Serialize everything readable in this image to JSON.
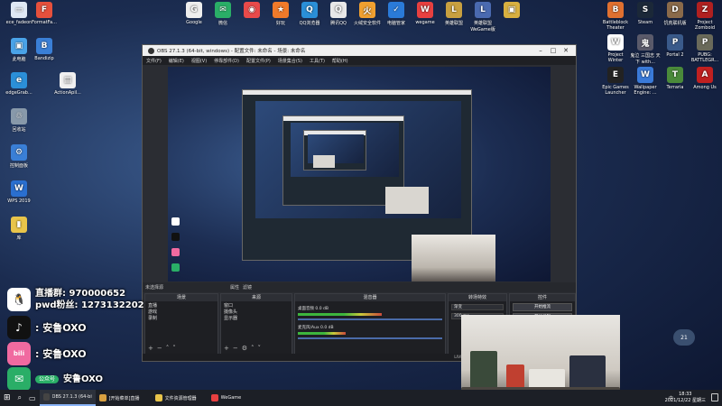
{
  "desktop": {
    "left_icons": [
      {
        "label": "ece_fadeon",
        "color": "#dfe8f5",
        "glyph": "▭"
      },
      {
        "label": "FormatFa...",
        "color": "#e6503c",
        "glyph": "F"
      },
      {
        "label": "此电脑",
        "color": "#4aa3e8",
        "glyph": "▣"
      },
      {
        "label": "Bandizip",
        "color": "#3a7fd6",
        "glyph": "B"
      },
      {
        "label": "edgeGrab...",
        "color": "#2b8fd8",
        "glyph": "e"
      },
      {
        "label": "ActionApil...",
        "color": "#f0f0f0",
        "glyph": "▤"
      },
      {
        "label": "回收站",
        "color": "#8899aa",
        "glyph": "♲"
      },
      {
        "label": "控制面板",
        "color": "#3a7fd6",
        "glyph": "⚙"
      },
      {
        "label": "WPS 2019",
        "color": "#2a6fd0",
        "glyph": "W"
      },
      {
        "label": "库",
        "color": "#e8c44a",
        "glyph": "▮"
      }
    ],
    "top_icons": [
      {
        "label": "Google",
        "color": "#eeeeee",
        "glyph": "G"
      },
      {
        "label": "微信",
        "color": "#2aae67",
        "glyph": "✉"
      },
      {
        "label": "",
        "color": "#e84a4a",
        "glyph": "◉"
      },
      {
        "label": "好玩",
        "color": "#f07a2a",
        "glyph": "★"
      },
      {
        "label": "QQ浏览器",
        "color": "#2a8fd8",
        "glyph": "Q"
      },
      {
        "label": "腾讯QQ",
        "color": "#e8e8e8",
        "glyph": "Q"
      },
      {
        "label": "火绒安全软件",
        "color": "#f0a030",
        "glyph": "火"
      },
      {
        "label": "电脑管家",
        "color": "#2a7ad8",
        "glyph": "✓"
      },
      {
        "label": "wegame",
        "color": "#e84040",
        "glyph": "W"
      },
      {
        "label": "英雄联盟",
        "color": "#c8a040",
        "glyph": "L"
      },
      {
        "label": "英雄联盟WeGame版",
        "color": "#4a6ab0",
        "glyph": "L"
      },
      {
        "label": "",
        "color": "#d8b040",
        "glyph": "▣"
      }
    ],
    "right_icons": [
      {
        "label": "Battleblock Theater",
        "color": "#e07030",
        "glyph": "B"
      },
      {
        "label": "Steam",
        "color": "#1b2838",
        "glyph": "S"
      },
      {
        "label": "饥荒联机版",
        "color": "#8a6a4a",
        "glyph": "D"
      },
      {
        "label": "Project Zomboid",
        "color": "#b02020",
        "glyph": "Z"
      },
      {
        "label": "Project Winter",
        "color": "#ffffff",
        "glyph": "W"
      },
      {
        "label": "鬼泣 三国志 天下 with...",
        "color": "#5a5a6a",
        "glyph": "鬼"
      },
      {
        "label": "Portal 2",
        "color": "#3a5a8a",
        "glyph": "P"
      },
      {
        "label": "PUBG: BATTLEGR...",
        "color": "#6a6a5a",
        "glyph": "P"
      },
      {
        "label": "Epic Games Launcher",
        "color": "#222222",
        "glyph": "E"
      },
      {
        "label": "Wallpaper Engine: ...",
        "color": "#3a7ad8",
        "glyph": "W"
      },
      {
        "label": "Terraria",
        "color": "#4a8a3a",
        "glyph": "T"
      },
      {
        "label": "Among Us",
        "color": "#c02020",
        "glyph": "A"
      }
    ]
  },
  "obs": {
    "title": "OBS 27.1.3 (64-bit, windows) - 配置文件: 未命名 - 场景: 未命名",
    "menu": [
      "文件(F)",
      "编辑(E)",
      "视图(V)",
      "停靠部件(D)",
      "配置文件(P)",
      "场景集合(S)",
      "工具(T)",
      "帮助(H)"
    ],
    "docks_header": [
      "未选择源",
      "属性",
      "滤镜"
    ],
    "scenes_title": "场景",
    "scenes": [
      "直播",
      "游戏",
      "录制"
    ],
    "sources_title": "来源",
    "sources": [
      "窗口",
      "摄像头",
      "显示器"
    ],
    "mixer_title": "混音器",
    "mixer_tracks": [
      {
        "label": "桌面音频",
        "value": "0.0 dB",
        "level": 0.62
      },
      {
        "label": "麦克风/Aux",
        "value": "0.0 dB",
        "level": 0.35
      }
    ],
    "transitions_title": "转场特效",
    "transition_value": "渐变",
    "transition_duration": "300 ms",
    "controls_title": "控件",
    "controls": [
      "开始推流",
      "开始录制",
      "工作室模式",
      "设置",
      "退出"
    ],
    "status": [
      "LIVE: 00:00:00",
      "REC: 00:00:00",
      "CPU: 1.9%, 30.00 fps"
    ]
  },
  "overlay": {
    "qq_line1": "直播群: 970000652",
    "qq_line2": "pwd粉丝: 1273132202",
    "douyin": ": 安鲁OXO",
    "bilibili": ": 安鲁OXO",
    "wechat_tag": "公众号",
    "wechat": "安鲁OXO"
  },
  "volume_badge": "21",
  "taskbar": {
    "items": [
      {
        "label": "OBS 27.1.3 (64-bit...",
        "color": "#444",
        "active": true
      },
      {
        "label": "[开始菜单]直播",
        "color": "#d8a040",
        "active": false
      },
      {
        "label": "文件资源管理器",
        "color": "#e8c44a",
        "active": false
      },
      {
        "label": "WeGame",
        "color": "#e84040",
        "active": false
      }
    ],
    "time": "18:33",
    "date": "2021/12/22 星期三",
    "lang": "中"
  },
  "colors": {
    "accent": "#8ab4f8",
    "obs_dark": "#2b2d33"
  }
}
